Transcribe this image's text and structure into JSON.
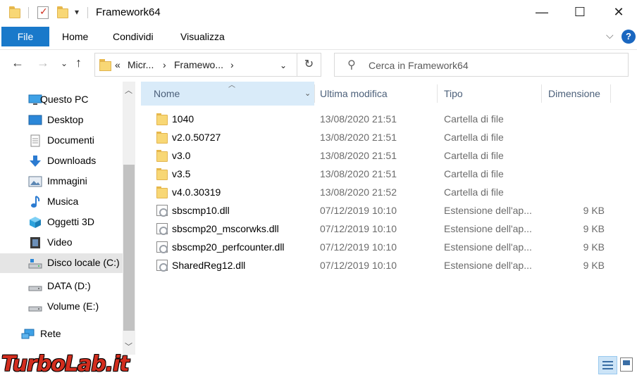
{
  "window": {
    "title": "Framework64",
    "minimize": "—",
    "maximize": "☐",
    "close": "✕"
  },
  "ribbon": {
    "file": "File",
    "tabs": [
      "Home",
      "Condividi",
      "Visualizza"
    ],
    "help": "?"
  },
  "address": {
    "prefix": "«",
    "segments": [
      "Micr...",
      "Framewo..."
    ],
    "separator": "›"
  },
  "search": {
    "placeholder": "Cerca in Framework64"
  },
  "nav": {
    "items": [
      {
        "label": "Questo PC",
        "icon": "computer-icon"
      },
      {
        "label": "Desktop",
        "icon": "desktop-icon"
      },
      {
        "label": "Documenti",
        "icon": "documents-icon"
      },
      {
        "label": "Downloads",
        "icon": "download-arrow-icon"
      },
      {
        "label": "Immagini",
        "icon": "pictures-icon"
      },
      {
        "label": "Musica",
        "icon": "music-note-icon"
      },
      {
        "label": "Oggetti 3D",
        "icon": "cube-3d-icon"
      },
      {
        "label": "Video",
        "icon": "film-icon"
      },
      {
        "label": "Disco locale (C:)",
        "icon": "local-disk-icon",
        "selected": true
      },
      {
        "label": "DATA (D:)",
        "icon": "drive-icon"
      },
      {
        "label": "Volume (E:)",
        "icon": "drive-icon"
      },
      {
        "label": "Rete",
        "icon": "network-icon"
      }
    ]
  },
  "columns": {
    "name": "Nome",
    "date": "Ultima modifica",
    "type": "Tipo",
    "size": "Dimensione"
  },
  "files": [
    {
      "name": "1040",
      "date": "13/08/2020 21:51",
      "type": "Cartella di file",
      "size": "",
      "kind": "folder"
    },
    {
      "name": "v2.0.50727",
      "date": "13/08/2020 21:51",
      "type": "Cartella di file",
      "size": "",
      "kind": "folder"
    },
    {
      "name": "v3.0",
      "date": "13/08/2020 21:51",
      "type": "Cartella di file",
      "size": "",
      "kind": "folder"
    },
    {
      "name": "v3.5",
      "date": "13/08/2020 21:51",
      "type": "Cartella di file",
      "size": "",
      "kind": "folder"
    },
    {
      "name": "v4.0.30319",
      "date": "13/08/2020 21:52",
      "type": "Cartella di file",
      "size": "",
      "kind": "folder"
    },
    {
      "name": "sbscmp10.dll",
      "date": "07/12/2019 10:10",
      "type": "Estensione dell'ap...",
      "size": "9 KB",
      "kind": "dll"
    },
    {
      "name": "sbscmp20_mscorwks.dll",
      "date": "07/12/2019 10:10",
      "type": "Estensione dell'ap...",
      "size": "9 KB",
      "kind": "dll"
    },
    {
      "name": "sbscmp20_perfcounter.dll",
      "date": "07/12/2019 10:10",
      "type": "Estensione dell'ap...",
      "size": "9 KB",
      "kind": "dll"
    },
    {
      "name": "SharedReg12.dll",
      "date": "07/12/2019 10:10",
      "type": "Estensione dell'ap...",
      "size": "9 KB",
      "kind": "dll"
    }
  ],
  "watermark": "TurboLab.it",
  "colors": {
    "accent": "#1979ca",
    "selection": "#d9ebf9",
    "folder": "#f8d775",
    "watermark": "#d22d1e"
  }
}
